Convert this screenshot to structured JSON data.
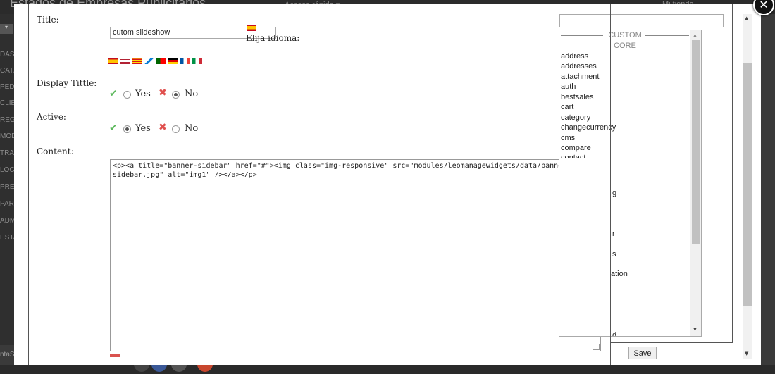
{
  "background": {
    "title": "Estados de Empresas Publicitarios",
    "quick_access": "Acceso rápido ▾",
    "shop_link": "Mi tienda",
    "side_items": [
      "DASH",
      "CATÁ",
      "PEDI",
      "CLIEN",
      "REGL",
      "MÓD",
      "TRAN",
      "LOCA",
      "PREF",
      "PARA",
      "ADMI",
      "ESTA"
    ],
    "footer_left": "ntaS"
  },
  "form": {
    "title_label": "Title:",
    "title_value": "cutom slideshow",
    "elija_label": "Elija idioma:",
    "display_title_label": "Display Tittle:",
    "active_label": "Active:",
    "content_label": "Content:",
    "yes": "Yes",
    "no": "No",
    "display_title_selected": "no",
    "active_selected": "yes",
    "content_value": "<p><a title=\"banner-sidebar\" href=\"#\"><img class=\"img-responsive\" src=\"modules/leomanagewidgets/data/banner-sidebar.jpg\" alt=\"img1\" /></a></p>"
  },
  "hooks": {
    "groups": [
      "CUSTOM",
      "CORE"
    ],
    "items": [
      "address",
      "addresses",
      "attachment",
      "auth",
      "bestsales",
      "cart",
      "category",
      "changecurrency",
      "cms",
      "compare",
      "contact"
    ],
    "partial_fragments": [
      "g",
      "r",
      "s",
      "ation",
      "d"
    ],
    "save_label": "Save"
  },
  "icons": {
    "close": "close-icon",
    "check": "check-icon",
    "cross": "cross-icon"
  },
  "colors": {
    "check": "#5cb85c",
    "cross": "#e0504e",
    "overlay": "#3a3a3a"
  }
}
